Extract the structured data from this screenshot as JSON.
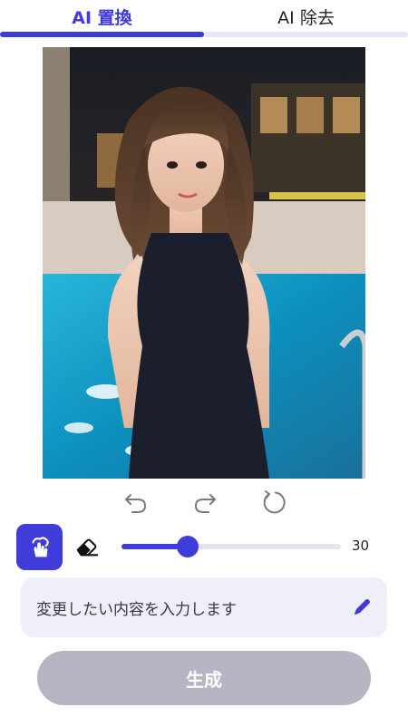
{
  "tabs": [
    {
      "label": "AI 置換",
      "active": true
    },
    {
      "label": "AI 除去",
      "active": false
    }
  ],
  "colors": {
    "accent": "#3e3bd8",
    "tab_track": "#e6e6f7",
    "prompt_bg": "#efeff9",
    "generate_bg": "#b5b5c3"
  },
  "history": {
    "undo_icon": "undo-icon",
    "redo_icon": "redo-icon",
    "reset_icon": "reset-icon"
  },
  "brush": {
    "brush_icon": "brush-hand-icon",
    "eraser_icon": "eraser-icon",
    "size_value": "30",
    "slider_fraction": 0.3
  },
  "prompt": {
    "placeholder": "変更したい内容を入力します",
    "icon": "pen-icon"
  },
  "generate": {
    "label": "生成"
  }
}
